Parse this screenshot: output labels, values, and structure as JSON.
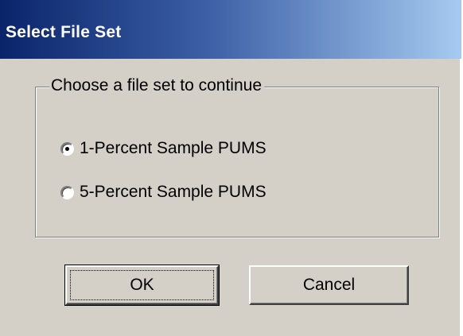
{
  "dialog": {
    "title": "Select File Set"
  },
  "group": {
    "legend": "Choose a file set to continue",
    "options": [
      {
        "label": "1-Percent Sample PUMS",
        "selected": true
      },
      {
        "label": "5-Percent Sample PUMS",
        "selected": false
      }
    ]
  },
  "buttons": {
    "ok_label": "OK",
    "cancel_label": "Cancel"
  },
  "colors": {
    "titlebar_start": "#0a246a",
    "titlebar_end": "#a6caf0",
    "face": "#d4d0c8"
  }
}
